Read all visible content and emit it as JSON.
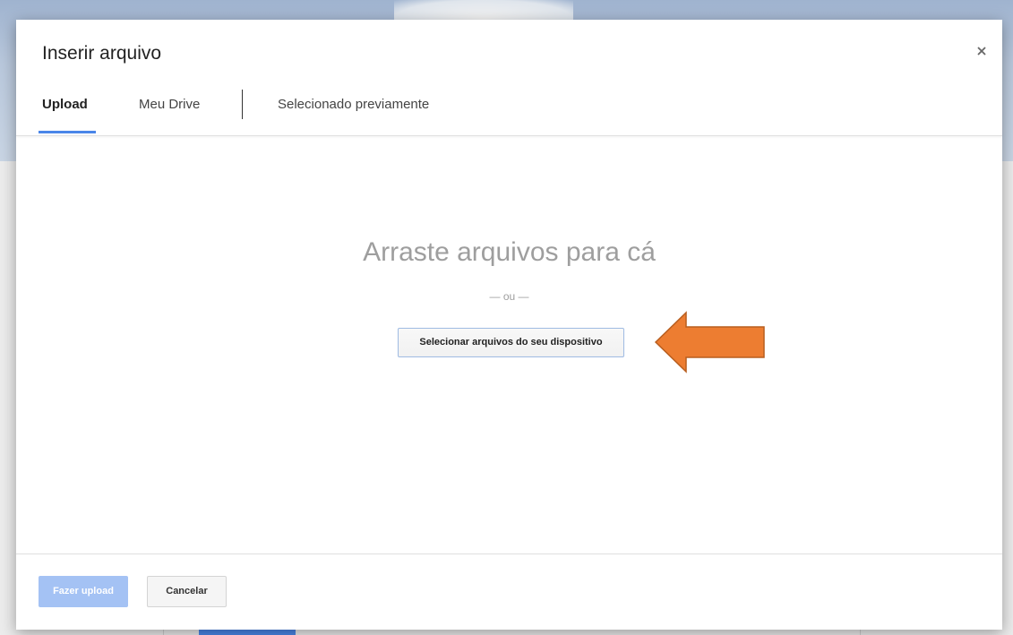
{
  "dialog": {
    "title": "Inserir arquivo",
    "close_icon": "close-icon"
  },
  "tabs": [
    {
      "label": "Upload",
      "active": true
    },
    {
      "label": "Meu Drive",
      "active": false
    },
    {
      "label": "Selecionado previamente",
      "active": false
    }
  ],
  "drop_zone": {
    "title": "Arraste arquivos para cá",
    "or_text": "— ou —",
    "select_button_label": "Selecionar arquivos do seu dispositivo"
  },
  "annotation": {
    "arrow_icon": "left-arrow-icon",
    "arrow_color": "#ed7d31"
  },
  "footer": {
    "upload_label": "Fazer upload",
    "cancel_label": "Cancelar"
  },
  "colors": {
    "accent": "#4a86e8",
    "upload_disabled": "#a4c2f4"
  }
}
